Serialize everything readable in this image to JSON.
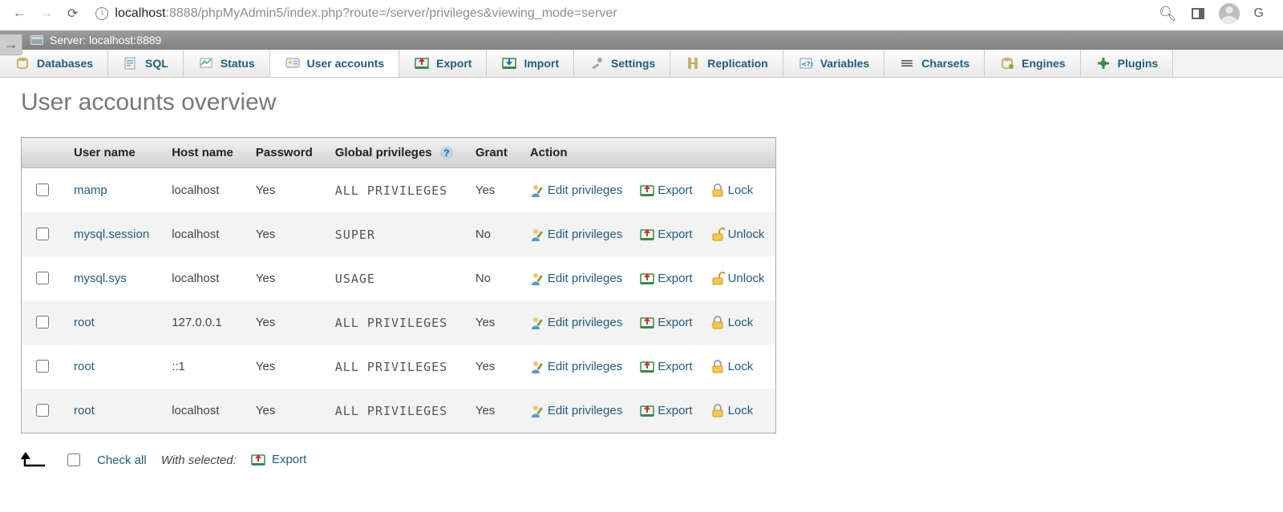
{
  "browser": {
    "url_host": "localhost",
    "url_port_path": ":8888/phpMyAdmin5/index.php?route=/server/privileges&viewing_mode=server",
    "profile_initial": "G"
  },
  "server_bar": {
    "label": "Server: localhost:8889"
  },
  "tabs": [
    {
      "id": "databases",
      "label": "Databases"
    },
    {
      "id": "sql",
      "label": "SQL"
    },
    {
      "id": "status",
      "label": "Status"
    },
    {
      "id": "useraccounts",
      "label": "User accounts",
      "active": true
    },
    {
      "id": "export",
      "label": "Export"
    },
    {
      "id": "import",
      "label": "Import"
    },
    {
      "id": "settings",
      "label": "Settings"
    },
    {
      "id": "replication",
      "label": "Replication"
    },
    {
      "id": "variables",
      "label": "Variables"
    },
    {
      "id": "charsets",
      "label": "Charsets"
    },
    {
      "id": "engines",
      "label": "Engines"
    },
    {
      "id": "plugins",
      "label": "Plugins"
    }
  ],
  "page_title": "User accounts overview",
  "columns": {
    "checkbox": "",
    "user": "User name",
    "host": "Host name",
    "password": "Password",
    "privs": "Global privileges",
    "grant": "Grant",
    "action": "Action"
  },
  "action_labels": {
    "edit": "Edit privileges",
    "export": "Export",
    "lock": "Lock",
    "unlock": "Unlock"
  },
  "rows": [
    {
      "user": "mamp",
      "host": "localhost",
      "password": "Yes",
      "privs": "ALL PRIVILEGES",
      "grant": "Yes",
      "lock_state": "lock"
    },
    {
      "user": "mysql.session",
      "host": "localhost",
      "password": "Yes",
      "privs": "SUPER",
      "grant": "No",
      "lock_state": "unlock"
    },
    {
      "user": "mysql.sys",
      "host": "localhost",
      "password": "Yes",
      "privs": "USAGE",
      "grant": "No",
      "lock_state": "unlock"
    },
    {
      "user": "root",
      "host": "127.0.0.1",
      "password": "Yes",
      "privs": "ALL PRIVILEGES",
      "grant": "Yes",
      "lock_state": "lock"
    },
    {
      "user": "root",
      "host": "::1",
      "password": "Yes",
      "privs": "ALL PRIVILEGES",
      "grant": "Yes",
      "lock_state": "lock"
    },
    {
      "user": "root",
      "host": "localhost",
      "password": "Yes",
      "privs": "ALL PRIVILEGES",
      "grant": "Yes",
      "lock_state": "lock"
    }
  ],
  "footer": {
    "check_all": "Check all",
    "with_selected": "With selected:",
    "export": "Export"
  }
}
